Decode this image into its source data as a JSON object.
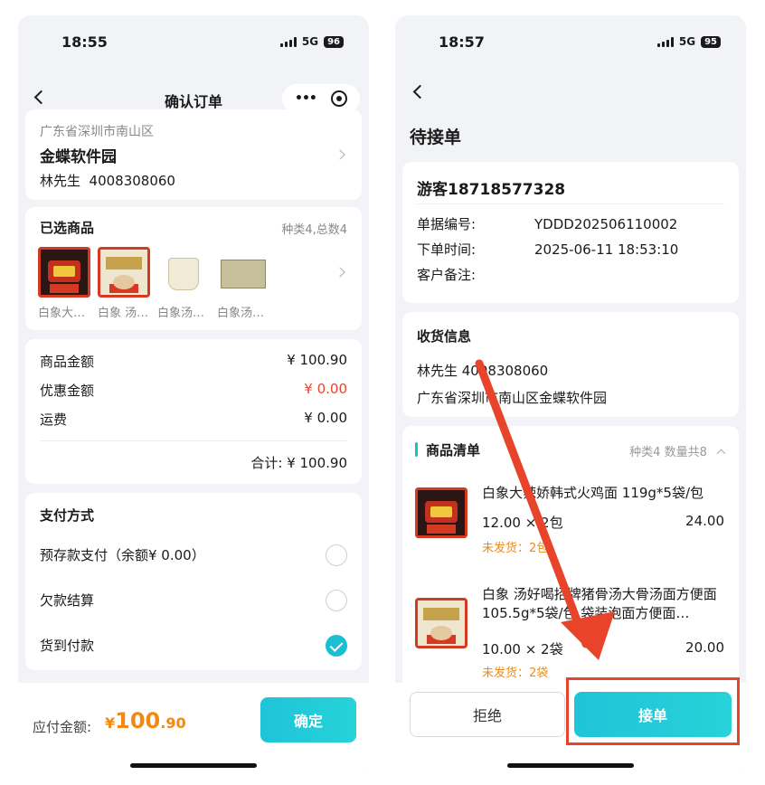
{
  "left": {
    "status": {
      "time": "18:55",
      "network": "5G",
      "battery": "96"
    },
    "nav": {
      "title": "确认订单"
    },
    "address": {
      "region": "广东省深圳市南山区",
      "place": "金蝶软件园",
      "contact": "林先生  4008308060"
    },
    "goods": {
      "title": "已选商品",
      "summary": "种类4,总数4",
      "items": [
        {
          "label": "白象大…",
          "icon": "noodle-pack-red"
        },
        {
          "label": "白象 汤…",
          "icon": "noodle-pack-cream"
        },
        {
          "label": "白象汤…",
          "icon": "noodle-cup"
        },
        {
          "label": "白象汤…",
          "icon": "noodle-box"
        }
      ]
    },
    "amounts": {
      "rows": [
        {
          "label": "商品金额",
          "value": "¥ 100.90"
        },
        {
          "label": "优惠金额",
          "value": "¥ 0.00"
        },
        {
          "label": "运费",
          "value": "¥ 0.00"
        }
      ],
      "total": "合计: ¥ 100.90"
    },
    "payment": {
      "title": "支付方式",
      "options": [
        {
          "label": "预存款支付（余额¥ 0.00）",
          "checked": false
        },
        {
          "label": "欠款结算",
          "checked": false
        },
        {
          "label": "货到付款",
          "checked": true
        }
      ]
    },
    "footer": {
      "label": "应付金额:",
      "currency": "¥",
      "amount_int": "100",
      "amount_dec": ".90",
      "confirm": "确定"
    }
  },
  "right": {
    "status": {
      "time": "18:57",
      "network": "5G",
      "battery": "95"
    },
    "page_title": "待接单",
    "customer": "游客18718577328",
    "order": {
      "fields": [
        {
          "label": "单据编号:",
          "value": "YDDD202506110002"
        },
        {
          "label": "下单时间:",
          "value": "2025-06-11 18:53:10"
        },
        {
          "label": "客户备注:",
          "value": ""
        }
      ]
    },
    "delivery": {
      "title": "收货信息",
      "contact": "林先生 4008308060",
      "address": "广东省深圳市南山区金蝶软件园"
    },
    "list": {
      "title": "商品清单",
      "summary": "种类4 数量共8",
      "items": [
        {
          "name": "白象大辣娇韩式火鸡面 119g*5袋/包",
          "qty": "12.00 × 2包",
          "total": "24.00",
          "pending": "未发货：2包"
        },
        {
          "name": "白象 汤好喝招牌猪骨汤大骨汤面方便面 105.5g*5袋/包 袋装泡面方便面…",
          "qty": "10.00 × 2袋",
          "total": "20.00",
          "pending": "未发货：2袋"
        }
      ]
    },
    "buttons": {
      "reject": "拒绝",
      "accept": "接单"
    }
  },
  "colors": {
    "accent": "#1bbfd4",
    "price": "#f08a12",
    "discount": "#e8442b",
    "annotation": "#e8442b"
  }
}
